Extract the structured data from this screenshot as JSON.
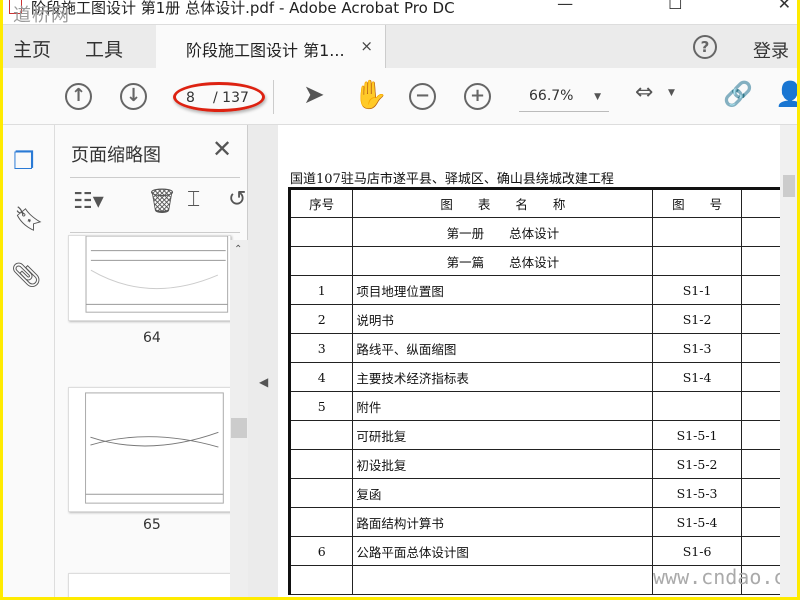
{
  "window": {
    "title": "阶段施工图设计 第1册 总体设计.pdf - Adobe Acrobat Pro DC",
    "watermark": "道桥网",
    "controls": "—  ☐  ✕"
  },
  "tabbar": {
    "home": "主页",
    "tools": "工具",
    "doc_tab": "阶段施工图设计 第1...",
    "close": "×",
    "help": "?",
    "login": "登录"
  },
  "toolbar": {
    "page_current": "8",
    "page_total": "/ 137",
    "zoom": "66.7%"
  },
  "panel": {
    "title": "页面缩略图",
    "close": "✕",
    "thumbs": [
      {
        "label": "64"
      },
      {
        "label": "65"
      }
    ]
  },
  "document": {
    "title": "国道107驻马店市遂平县、驿城区、确山县绕城改建工程",
    "headers": {
      "no": "序号",
      "name": "图　　表　　名　　称",
      "code": "图　　号"
    },
    "sections": [
      "第一册　　总体设计",
      "第一篇　　总体设计"
    ],
    "rows": [
      {
        "no": "1",
        "name": "项目地理位置图",
        "code": "S1-1"
      },
      {
        "no": "2",
        "name": "说明书",
        "code": "S1-2"
      },
      {
        "no": "3",
        "name": "路线平、纵面缩图",
        "code": "S1-3"
      },
      {
        "no": "4",
        "name": "主要技术经济指标表",
        "code": "S1-4"
      },
      {
        "no": "5",
        "name": "附件",
        "code": ""
      },
      {
        "no": "",
        "name": "可研批复",
        "code": "S1-5-1"
      },
      {
        "no": "",
        "name": "初设批复",
        "code": "S1-5-2"
      },
      {
        "no": "",
        "name": "复函",
        "code": "S1-5-3"
      },
      {
        "no": "",
        "name": "路面结构计算书",
        "code": "S1-5-4"
      },
      {
        "no": "6",
        "name": "公路平面总体设计图",
        "code": "S1-6"
      }
    ],
    "watermark": "www.cndao.com"
  }
}
